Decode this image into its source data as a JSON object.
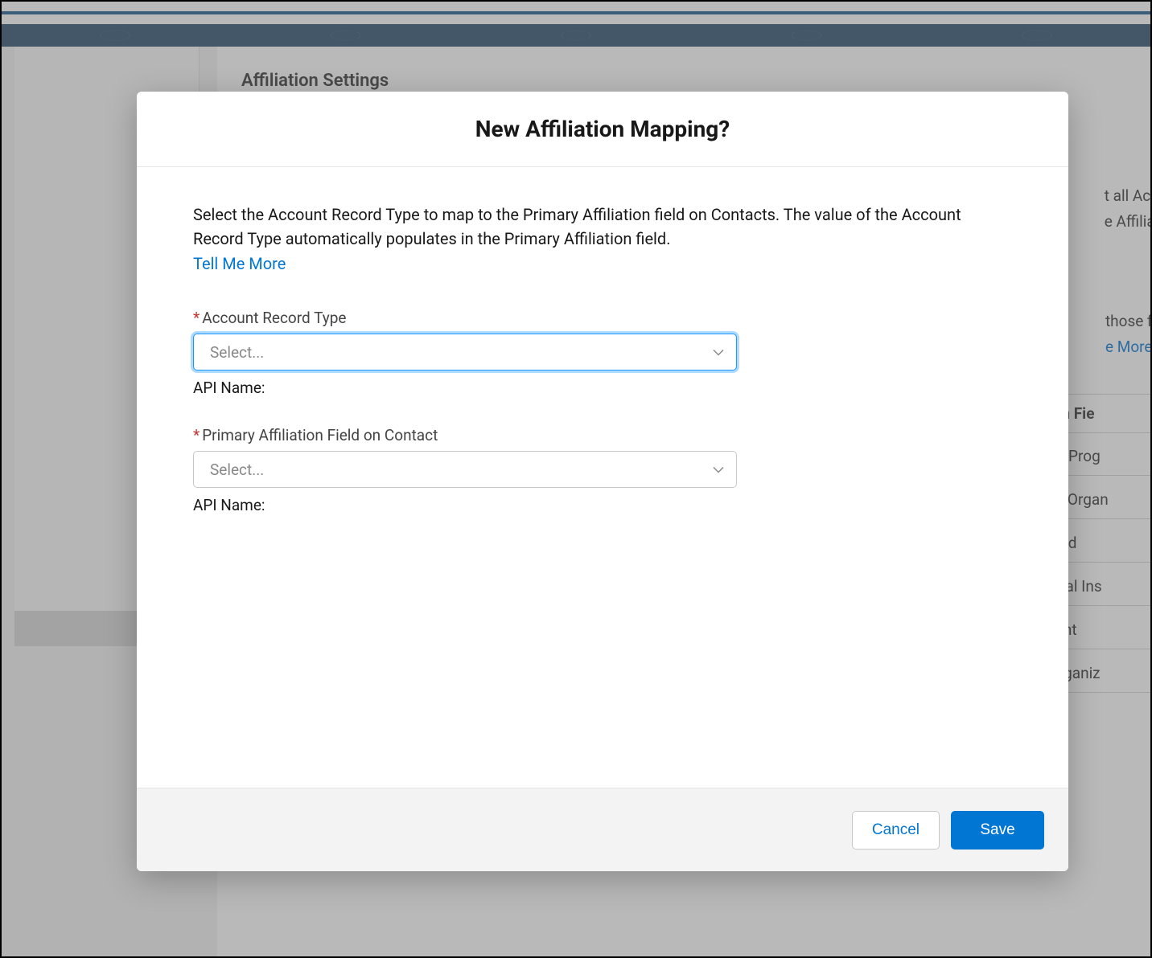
{
  "background": {
    "page_title": "Affiliation Settings",
    "paragraph1_line1": "t all Accoun",
    "paragraph1_line2": "e Affiliation",
    "paragraph2_line1": "those field",
    "paragraph2_link": "e More",
    "table_header": "iation Fie",
    "rows": [
      "emic Prog",
      "ness Organ",
      "sehold",
      "ational Ins",
      "rtment",
      "ts Organiz"
    ]
  },
  "modal": {
    "title": "New Affiliation Mapping?",
    "instructions": "Select the Account Record Type to map to the Primary Affiliation field on Contacts. The value of the Account Record Type automatically populates in the Primary Affiliation field.",
    "tell_me_more": "Tell Me More",
    "fields": {
      "account_record_type": {
        "label": "Account Record Type",
        "placeholder": "Select...",
        "api_name_label": "API Name:"
      },
      "primary_affiliation": {
        "label": "Primary Affiliation Field on Contact",
        "placeholder": "Select...",
        "api_name_label": "API Name:"
      }
    },
    "buttons": {
      "cancel": "Cancel",
      "save": "Save"
    }
  }
}
